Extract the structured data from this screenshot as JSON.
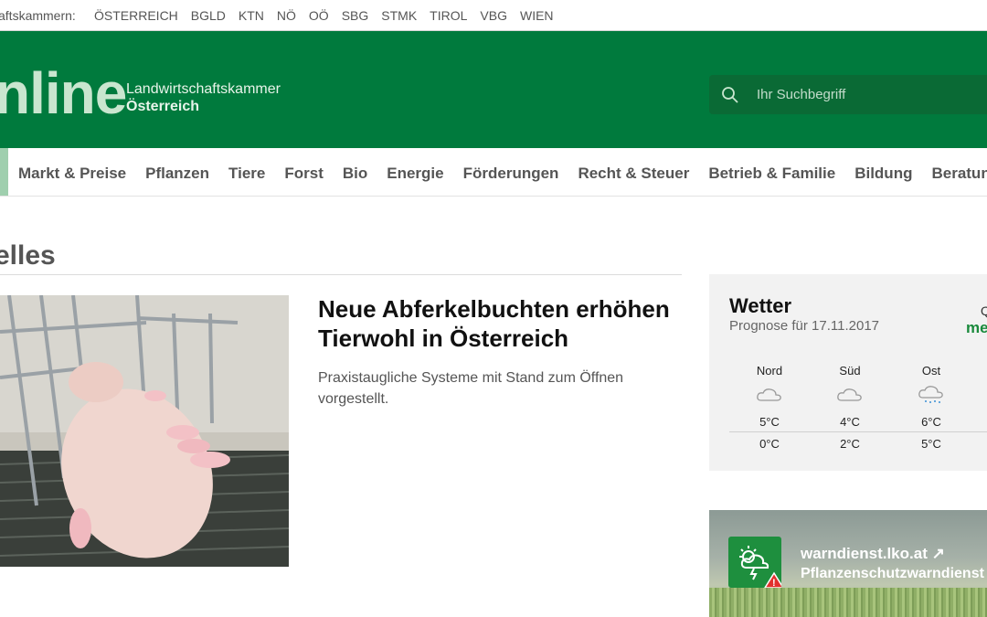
{
  "topbar": {
    "prefix": "aftskammern:",
    "chambers": [
      "ÖSTERREICH",
      "BGLD",
      "KTN",
      "NÖ",
      "OÖ",
      "SBG",
      "STMK",
      "TIROL",
      "VBG",
      "WIEN"
    ]
  },
  "header": {
    "logo_word": "nline",
    "logo_sub1": "Landwirtschaftskammer",
    "logo_sub2": "Österreich",
    "search_placeholder": "Ihr Suchbegriff",
    "brand_color": "#007a3d"
  },
  "nav": {
    "items": [
      "Markt & Preise",
      "Pflanzen",
      "Tiere",
      "Forst",
      "Bio",
      "Energie",
      "Förderungen",
      "Recht & Steuer",
      "Betrieb & Familie",
      "Bildung",
      "Beratung"
    ]
  },
  "section": {
    "title": "elles"
  },
  "article": {
    "title": "Neue Abferkelbuchten erhöhen Tierwohl in Österreich",
    "teaser": "Praxistaugliche Systeme mit Stand zum Öffnen vorgestellt."
  },
  "weather": {
    "title": "Wetter",
    "subtitle": "Prognose für 17.11.2017",
    "q_label": "Q",
    "more_label": "me",
    "regions": [
      {
        "name": "Nord",
        "icon": "cloudy-icon",
        "max": "5°C",
        "min": "0°C"
      },
      {
        "name": "Süd",
        "icon": "cloudy-icon",
        "max": "4°C",
        "min": "2°C"
      },
      {
        "name": "Ost",
        "icon": "rain-cloud-icon",
        "max": "6°C",
        "min": "5°C"
      }
    ]
  },
  "warn": {
    "name": "warndienst.lko.at ↗",
    "desc": "Pflanzenschutzwarndienst"
  }
}
